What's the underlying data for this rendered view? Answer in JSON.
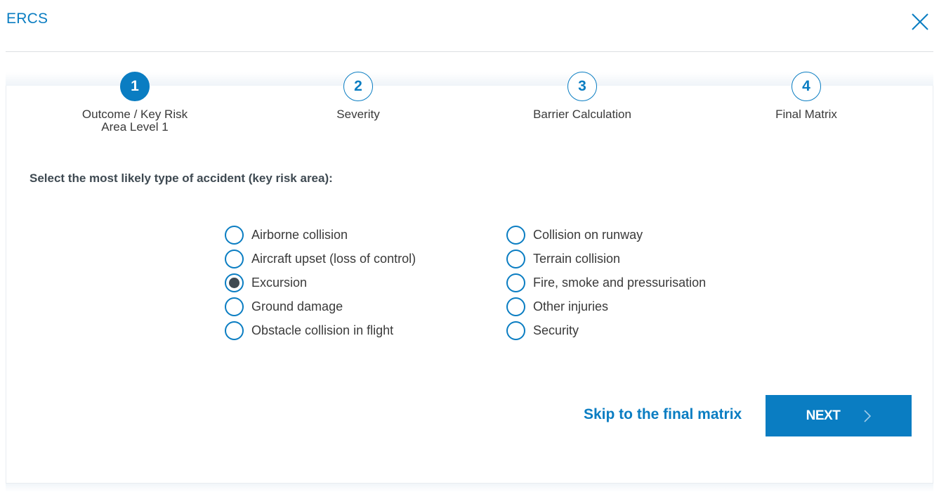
{
  "header": {
    "title": "ERCS",
    "close_icon": "close-icon"
  },
  "stepper": {
    "steps": [
      {
        "number": "1",
        "label": "Outcome / Key Risk\nArea Level 1",
        "label_line1": "Outcome / Key Risk",
        "label_line2": "Area Level 1",
        "active": true
      },
      {
        "number": "2",
        "label": "Severity",
        "active": false
      },
      {
        "number": "3",
        "label": "Barrier Calculation",
        "active": false
      },
      {
        "number": "4",
        "label": "Final Matrix",
        "active": false
      }
    ]
  },
  "question": {
    "instruction": "Select the most likely type of accident (key risk area):",
    "selected": "Excursion",
    "options_left": [
      {
        "label": "Airborne collision",
        "checked": false
      },
      {
        "label": "Aircraft upset (loss of control)",
        "checked": false
      },
      {
        "label": "Excursion",
        "checked": true
      },
      {
        "label": "Ground damage",
        "checked": false
      },
      {
        "label": "Obstacle collision in flight",
        "checked": false
      }
    ],
    "options_right": [
      {
        "label": "Collision on runway",
        "checked": false
      },
      {
        "label": "Terrain collision",
        "checked": false
      },
      {
        "label": "Fire, smoke and pressurisation",
        "checked": false
      },
      {
        "label": "Other injuries",
        "checked": false
      },
      {
        "label": "Security",
        "checked": false
      }
    ]
  },
  "actions": {
    "skip_label": "Skip to the final matrix",
    "next_label": "NEXT",
    "next_icon": "chevron-right-icon"
  },
  "colors": {
    "accent": "#0a7dc2",
    "selected_dot": "#3f4a52",
    "text": "#3a3a3a"
  }
}
